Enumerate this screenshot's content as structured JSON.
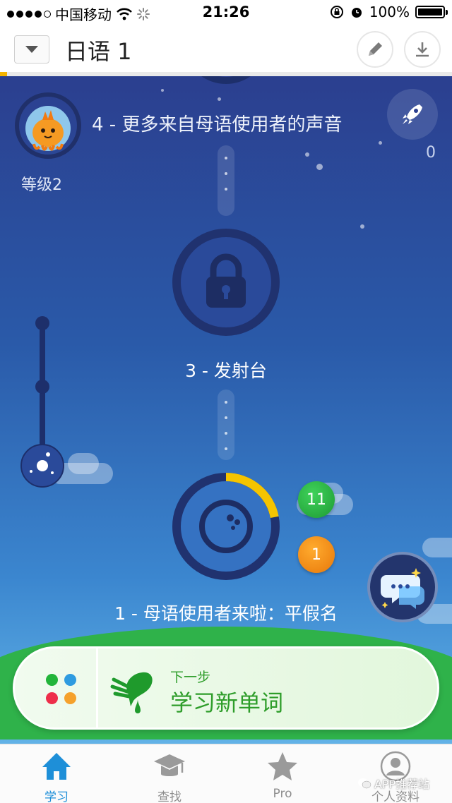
{
  "status_bar": {
    "carrier": "中国移动",
    "time": "21:26",
    "battery": "100%"
  },
  "header": {
    "course_title": "日语 1",
    "dropdown_icon": "chevron-down-icon",
    "edit_icon": "pencil-icon",
    "download_icon": "download-icon",
    "progress_fraction": 0.015,
    "progress_color": "#f5b400"
  },
  "scene": {
    "level_label": "等级2",
    "next_level_title": "4 - 更多来自母语使用者的声音",
    "rocket_count": "0",
    "locked_level_title": "3 - 发射台",
    "current_level_title": "1 - 母语使用者来啦：平假名",
    "current_level_progress_fraction": 0.22,
    "badge_green": "11",
    "badge_orange": "1",
    "colors": {
      "ring_progress": "#f5c400",
      "badge_green": "#27b040",
      "badge_orange": "#f08a12"
    }
  },
  "next_step": {
    "subtitle": "下一步",
    "title": "学习新单词",
    "accent": "#2e9d2a"
  },
  "tabs": [
    {
      "label": "学习",
      "icon": "home-icon",
      "active": true
    },
    {
      "label": "查找",
      "icon": "graduation-cap-icon",
      "active": false
    },
    {
      "label": "Pro",
      "icon": "star-icon",
      "active": false
    },
    {
      "label": "个人资料",
      "icon": "profile-icon",
      "active": false
    }
  ],
  "watermark": "APP推荐站"
}
